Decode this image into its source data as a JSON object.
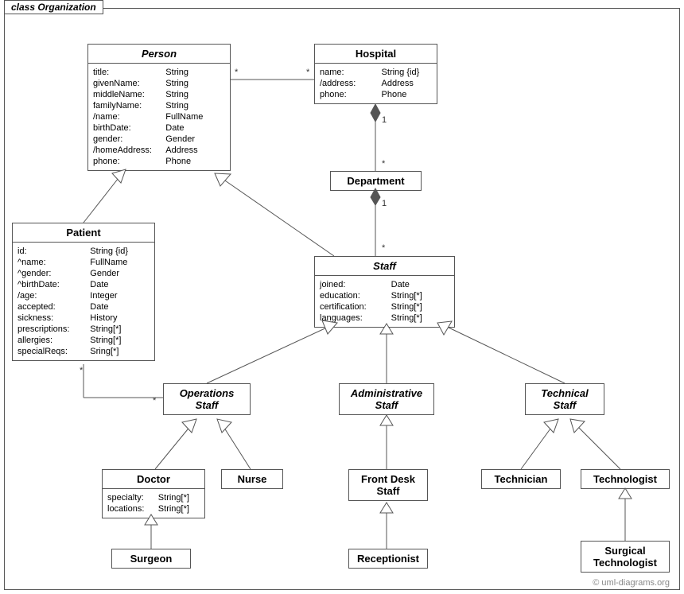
{
  "frame_title": "class Organization",
  "watermark": "© uml-diagrams.org",
  "classes": {
    "person": {
      "name": "Person",
      "attrs": [
        {
          "k": "title:",
          "v": "String"
        },
        {
          "k": "givenName:",
          "v": "String"
        },
        {
          "k": "middleName:",
          "v": "String"
        },
        {
          "k": "familyName:",
          "v": "String"
        },
        {
          "k": "/name:",
          "v": "FullName"
        },
        {
          "k": "birthDate:",
          "v": "Date"
        },
        {
          "k": "gender:",
          "v": "Gender"
        },
        {
          "k": "/homeAddress:",
          "v": "Address"
        },
        {
          "k": "phone:",
          "v": "Phone"
        }
      ]
    },
    "hospital": {
      "name": "Hospital",
      "attrs": [
        {
          "k": "name:",
          "v": "String {id}"
        },
        {
          "k": "/address:",
          "v": "Address"
        },
        {
          "k": "phone:",
          "v": "Phone"
        }
      ]
    },
    "department": {
      "name": "Department"
    },
    "patient": {
      "name": "Patient",
      "attrs": [
        {
          "k": "id:",
          "v": "String {id}"
        },
        {
          "k": "^name:",
          "v": "FullName"
        },
        {
          "k": "^gender:",
          "v": "Gender"
        },
        {
          "k": "^birthDate:",
          "v": "Date"
        },
        {
          "k": "/age:",
          "v": "Integer"
        },
        {
          "k": "accepted:",
          "v": "Date"
        },
        {
          "k": "sickness:",
          "v": "History"
        },
        {
          "k": "prescriptions:",
          "v": "String[*]"
        },
        {
          "k": "allergies:",
          "v": "String[*]"
        },
        {
          "k": "specialReqs:",
          "v": "Sring[*]"
        }
      ]
    },
    "staff": {
      "name": "Staff",
      "attrs": [
        {
          "k": "joined:",
          "v": "Date"
        },
        {
          "k": "education:",
          "v": "String[*]"
        },
        {
          "k": "certification:",
          "v": "String[*]"
        },
        {
          "k": "languages:",
          "v": "String[*]"
        }
      ]
    },
    "ops_staff": {
      "name": "Operations\nStaff"
    },
    "admin_staff": {
      "name": "Administrative\nStaff"
    },
    "tech_staff": {
      "name": "Technical\nStaff"
    },
    "doctor": {
      "name": "Doctor",
      "attrs": [
        {
          "k": "specialty:",
          "v": "String[*]"
        },
        {
          "k": "locations:",
          "v": "String[*]"
        }
      ]
    },
    "nurse": {
      "name": "Nurse"
    },
    "front_desk": {
      "name": "Front Desk\nStaff"
    },
    "technician": {
      "name": "Technician"
    },
    "technologist": {
      "name": "Technologist"
    },
    "surgeon": {
      "name": "Surgeon"
    },
    "receptionist": {
      "name": "Receptionist"
    },
    "surg_tech": {
      "name": "Surgical\nTechnologist"
    }
  },
  "multiplicities": {
    "person_hospital_l": "*",
    "person_hospital_r": "*",
    "hospital_dept_top": "1",
    "hospital_dept_bot": "*",
    "dept_staff_top": "1",
    "dept_staff_bot": "*",
    "patient_ops_l": "*",
    "patient_ops_r": "*"
  }
}
